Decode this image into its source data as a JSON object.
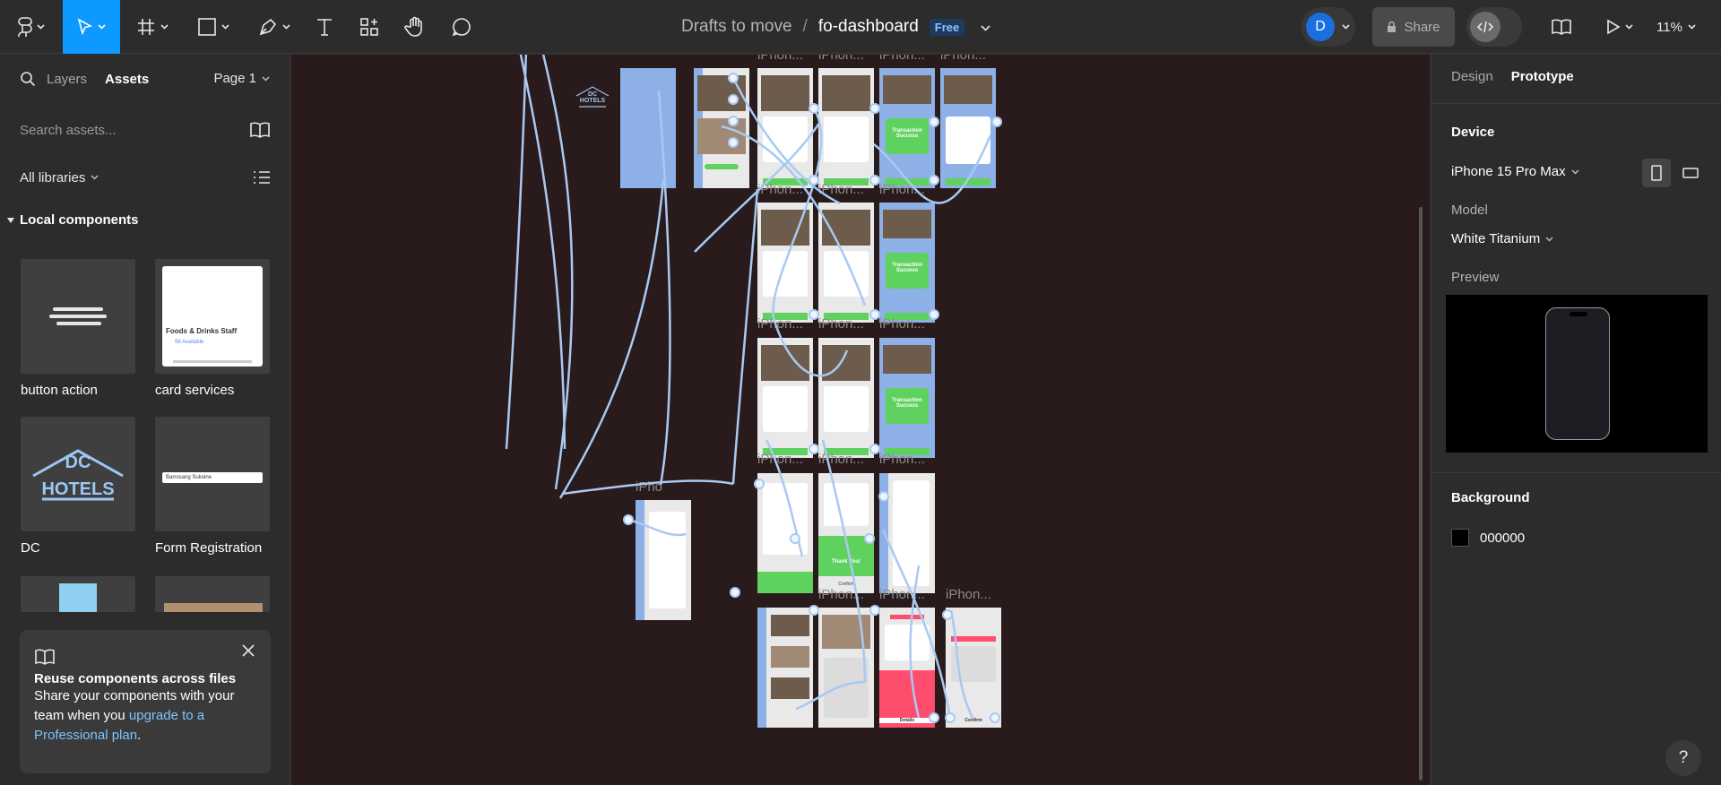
{
  "toolbar": {
    "file_path": {
      "project": "Drafts to move",
      "separator": "/",
      "file": "fo-dashboard",
      "plan_badge": "Free"
    },
    "avatar_initial": "D",
    "share_label": "Share",
    "zoom_label": "11%"
  },
  "left_panel": {
    "tabs": {
      "layers": "Layers",
      "assets": "Assets"
    },
    "page_selector": "Page 1",
    "search_placeholder": "Search assets...",
    "libraries_label": "All libraries",
    "section_label": "Local components",
    "components": [
      {
        "name": "button action"
      },
      {
        "name": "card services",
        "thumb_title": "Foods & Drinks Staff",
        "thumb_sub": "98 Available"
      },
      {
        "name": "DC",
        "thumb_line1": "DC",
        "thumb_line2": "HOTELS"
      },
      {
        "name": "Form Registration",
        "thumb_field": "Barrosang Sukoine"
      }
    ],
    "tip": {
      "title": "Reuse components across files",
      "body": "Share your components with your team when you ",
      "link": "upgrade to a Professional plan",
      "end": "."
    }
  },
  "canvas": {
    "frame_label": "iPhon...",
    "frame_label_short": "iPho",
    "logo_line1": "DC",
    "logo_line2": "HOTELS",
    "success_text": "Transaction Success",
    "thank_you_text": "Thank You!",
    "confirm_text": "Confirm",
    "details_text": "Details",
    "connector_color": "#a9c9f2"
  },
  "right_panel": {
    "tabs": {
      "design": "Design",
      "prototype": "Prototype"
    },
    "device_heading": "Device",
    "device_value": "iPhone 15 Pro Max",
    "model_heading": "Model",
    "model_value": "White Titanium",
    "preview_heading": "Preview",
    "background_heading": "Background",
    "background_value": "000000"
  },
  "colors": {
    "accent": "#0d99ff",
    "canvas_bg": "#291b1b",
    "panel_bg": "#2c2c2c",
    "link": "#7cc4ff"
  }
}
